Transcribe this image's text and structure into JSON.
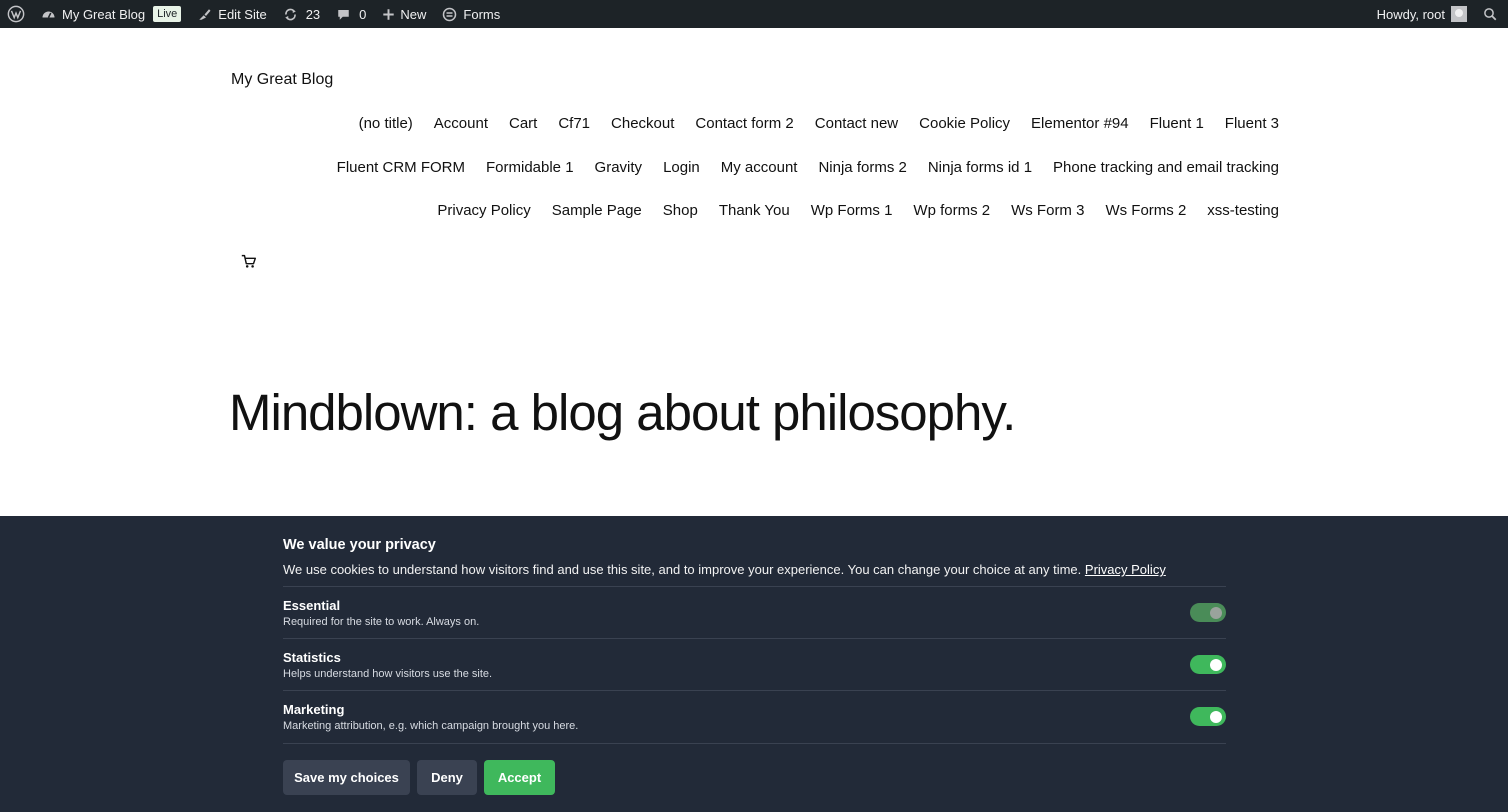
{
  "admin_bar": {
    "site_name": "My Great Blog",
    "live_badge": "Live",
    "edit_site": "Edit Site",
    "updates_count": "23",
    "comments_count": "0",
    "new_label": "New",
    "forms_label": "Forms",
    "howdy": "Howdy, root"
  },
  "site": {
    "title": "My Great Blog",
    "nav_items": [
      "(no title)",
      "Account",
      "Cart",
      "Cf71",
      "Checkout",
      "Contact form 2",
      "Contact new",
      "Cookie Policy",
      "Elementor #94",
      "Fluent 1",
      "Fluent 3",
      "Fluent CRM FORM",
      "Formidable 1",
      "Gravity",
      "Login",
      "My account",
      "Ninja forms 2",
      "Ninja forms id 1",
      "Phone tracking and email tracking",
      "Privacy Policy",
      "Sample Page",
      "Shop",
      "Thank You",
      "Wp Forms 1",
      "Wp forms 2",
      "Ws Form 3",
      "Ws Forms 2",
      "xss-testing"
    ],
    "hero_title": "Mindblown: a blog about philosophy."
  },
  "consent": {
    "title": "We value your privacy",
    "text": "We use cookies to understand how visitors find and use this site, and to improve your experience. You can change your choice at any time.",
    "privacy_link": "Privacy Policy",
    "categories": [
      {
        "title": "Essential",
        "desc": "Required for the site to work. Always on.",
        "enabled": true,
        "locked": true
      },
      {
        "title": "Statistics",
        "desc": "Helps understand how visitors use the site.",
        "enabled": true,
        "locked": false
      },
      {
        "title": "Marketing",
        "desc": "Marketing attribution, e.g. which campaign brought you here.",
        "enabled": true,
        "locked": false
      }
    ],
    "buttons": {
      "save": "Save my choices",
      "deny": "Deny",
      "accept": "Accept"
    },
    "colors": {
      "banner_bg": "#222a38",
      "accept_green": "#3fb85c",
      "secondary_button": "#3a4252"
    }
  }
}
